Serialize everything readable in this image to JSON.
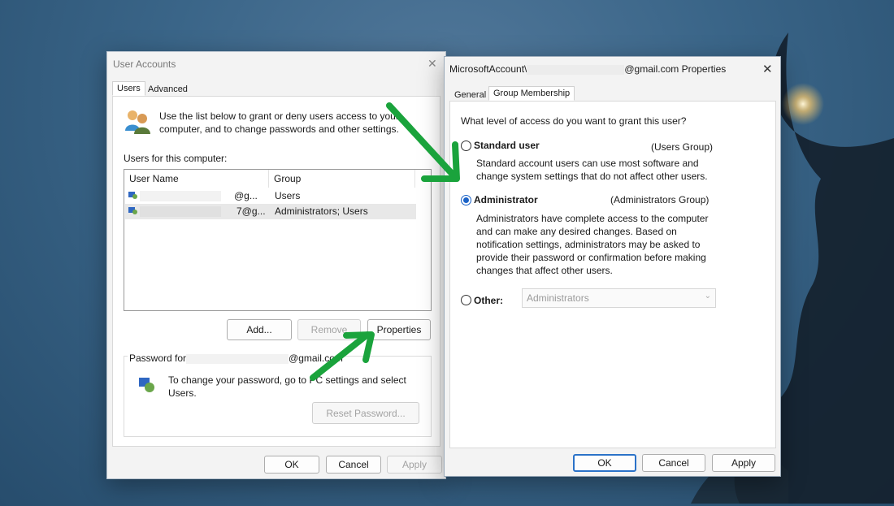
{
  "user_accounts": {
    "title": "User Accounts",
    "tabs": [
      "Users",
      "Advanced"
    ],
    "intro_text_line1": "Use the list below to grant or deny users access to your",
    "intro_text_line2": "computer, and to change passwords and other settings.",
    "users_label": "Users for this computer:",
    "columns": [
      "User Name",
      "Group"
    ],
    "rows": [
      {
        "name": "@g...",
        "group": "Users"
      },
      {
        "name": "7@g...",
        "group": "Administrators; Users"
      }
    ],
    "buttons": {
      "add": "Add...",
      "remove": "Remove",
      "properties": "Properties"
    },
    "password_for_label": "Password for",
    "password_for_email": "@gmail.com",
    "password_text_line1": "To change your password, go to PC settings and select",
    "password_text_line2": "Users.",
    "reset_password": "Reset Password...",
    "ok": "OK",
    "cancel": "Cancel",
    "apply": "Apply"
  },
  "properties": {
    "title_prefix": "MicrosoftAccount\\",
    "title_suffix": "@gmail.com Properties",
    "tabs": [
      "General",
      "Group Membership"
    ],
    "question": "What level of access do you want to grant this user?",
    "standard": {
      "label": "Standard user",
      "group": "(Users Group)",
      "desc_line1": "Standard account users can use most software and",
      "desc_line2": "change system settings that do not affect other users."
    },
    "administrator": {
      "label": "Administrator",
      "group": "(Administrators Group)",
      "desc_line1": "Administrators have complete access to the computer",
      "desc_line2": "and can make any desired changes. Based on",
      "desc_line3": "notification settings, administrators may be asked to",
      "desc_line4": "provide their password or confirmation before making",
      "desc_line5": "changes that affect other users."
    },
    "other": {
      "label": "Other:",
      "value": "Administrators"
    },
    "selected": "Administrator",
    "ok": "OK",
    "cancel": "Cancel",
    "apply": "Apply"
  },
  "colors": {
    "accent": "#1a62c7",
    "arrow": "#1aa33c",
    "desktop": "#3a6588"
  }
}
